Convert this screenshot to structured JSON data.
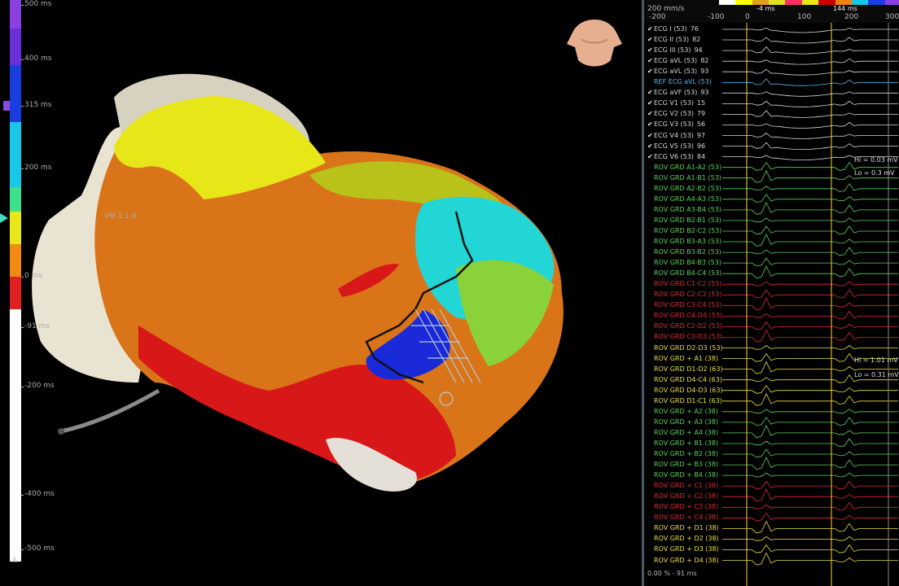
{
  "scale": {
    "ticks": [
      "500 ms",
      "400 ms",
      "315 ms",
      "200 ms",
      "0 ms",
      "-91 ms",
      "-200 ms",
      "-400 ms",
      "-500 ms"
    ],
    "colors": [
      "#8a3fe0",
      "#6a2fd8",
      "#1a3de0",
      "#19c8e8",
      "#3ee08a",
      "#e8e818",
      "#f08a10",
      "#e02020",
      "#ffffff"
    ]
  },
  "map": {
    "label": "VM 1.1.6"
  },
  "panel": {
    "sweep": "200 mm/s",
    "axis": [
      "-200",
      "-100",
      "0",
      "100",
      "200",
      "300"
    ],
    "ruler_a": "-4 ms",
    "ruler_b": "144 ms",
    "channels": [
      {
        "name": "ECG I (53)",
        "val": "76",
        "color": "#d8d8d8",
        "checked": true
      },
      {
        "name": "ECG II (53)",
        "val": "82",
        "color": "#d8d8d8",
        "checked": true
      },
      {
        "name": "ECG III (53)",
        "val": "94",
        "color": "#d8d8d8",
        "checked": true
      },
      {
        "name": "ECG aVL (53)",
        "val": "82",
        "color": "#d8d8d8",
        "checked": true
      },
      {
        "name": "ECG aVL (53)",
        "val": "93",
        "color": "#d8d8d8",
        "checked": true
      },
      {
        "name": "REF ECG aVL (53)",
        "val": "",
        "color": "#5ab8f0",
        "checked": false
      },
      {
        "name": "ECG aVF (53)",
        "val": "93",
        "color": "#d8d8d8",
        "checked": true
      },
      {
        "name": "ECG V1 (53)",
        "val": "15",
        "color": "#d8d8d8",
        "checked": true
      },
      {
        "name": "ECG V2 (53)",
        "val": "79",
        "color": "#d8d8d8",
        "checked": true
      },
      {
        "name": "ECG V3 (53)",
        "val": "56",
        "color": "#d8d8d8",
        "checked": true
      },
      {
        "name": "ECG V4 (53)",
        "val": "97",
        "color": "#d8d8d8",
        "checked": true
      },
      {
        "name": "ECG V5 (53)",
        "val": "96",
        "color": "#d8d8d8",
        "checked": true
      },
      {
        "name": "ECG V6 (53)",
        "val": "84",
        "color": "#d8d8d8",
        "checked": true
      },
      {
        "name": "ROV GRD A1-A2 (53)",
        "val": "",
        "color": "#5ad45a",
        "checked": false
      },
      {
        "name": "ROV GRD A1-B1 (53)",
        "val": "",
        "color": "#5ad45a",
        "checked": false
      },
      {
        "name": "ROV GRD A2-B2 (53)",
        "val": "",
        "color": "#5ad45a",
        "checked": false
      },
      {
        "name": "ROV GRD A4-A3 (53)",
        "val": "",
        "color": "#5ad45a",
        "checked": false
      },
      {
        "name": "ROV GRD A3-B4 (53)",
        "val": "",
        "color": "#5ad45a",
        "checked": false
      },
      {
        "name": "ROV GRD B2-B1 (53)",
        "val": "",
        "color": "#5ad45a",
        "checked": false
      },
      {
        "name": "ROV GRD B2-C2 (53)",
        "val": "",
        "color": "#5ad45a",
        "checked": false
      },
      {
        "name": "ROV GRD B3-A3 (53)",
        "val": "",
        "color": "#5ad45a",
        "checked": false
      },
      {
        "name": "ROV GRD B3-B2 (53)",
        "val": "",
        "color": "#5ad45a",
        "checked": false
      },
      {
        "name": "ROV GRD B4-B3 (53)",
        "val": "",
        "color": "#5ad45a",
        "checked": false
      },
      {
        "name": "ROV GRD B4-C4 (53)",
        "val": "",
        "color": "#5ad45a",
        "checked": false
      },
      {
        "name": "ROV GRD C1-C2 (53)",
        "val": "",
        "color": "#e0283a",
        "checked": false
      },
      {
        "name": "ROV GRD C2-C3 (53)",
        "val": "",
        "color": "#e0283a",
        "checked": false
      },
      {
        "name": "ROV GRD C3-C4 (53)",
        "val": "",
        "color": "#e0283a",
        "checked": false
      },
      {
        "name": "ROV GRD C4-D4 (53)",
        "val": "",
        "color": "#e0283a",
        "checked": false
      },
      {
        "name": "ROV GRD C2-D2 (53)",
        "val": "",
        "color": "#e0283a",
        "checked": false
      },
      {
        "name": "ROV GRD C3-D3 (53)",
        "val": "",
        "color": "#e0283a",
        "checked": false
      },
      {
        "name": "ROV GRD D2-D3 (53)",
        "val": "",
        "color": "#e8e040",
        "checked": false
      },
      {
        "name": "ROV GRD + A1 (38)",
        "val": "",
        "color": "#e8e040",
        "checked": false
      },
      {
        "name": "ROV GRD D1-D2 (63)",
        "val": "",
        "color": "#e8e040",
        "checked": false
      },
      {
        "name": "ROV GRD D4-C4 (63)",
        "val": "",
        "color": "#e8e040",
        "checked": false
      },
      {
        "name": "ROV GRD D4-D3 (63)",
        "val": "",
        "color": "#e8e040",
        "checked": false
      },
      {
        "name": "ROV GRD D1-C1 (63)",
        "val": "",
        "color": "#e8e040",
        "checked": false
      },
      {
        "name": "ROV GRD + A2 (38)",
        "val": "",
        "color": "#5ad45a",
        "checked": false
      },
      {
        "name": "ROV GRD + A3 (38)",
        "val": "",
        "color": "#5ad45a",
        "checked": false
      },
      {
        "name": "ROV GRD + A4 (38)",
        "val": "",
        "color": "#5ad45a",
        "checked": false
      },
      {
        "name": "ROV GRD + B1 (38)",
        "val": "",
        "color": "#5ad45a",
        "checked": false
      },
      {
        "name": "ROV GRD + B2 (38)",
        "val": "",
        "color": "#5ad45a",
        "checked": false
      },
      {
        "name": "ROV GRD + B3 (38)",
        "val": "",
        "color": "#5ad45a",
        "checked": false
      },
      {
        "name": "ROV GRD + B4 (38)",
        "val": "",
        "color": "#5ad45a",
        "checked": false
      },
      {
        "name": "ROV GRD + C1 (38)",
        "val": "",
        "color": "#e0283a",
        "checked": false
      },
      {
        "name": "ROV GRD + C2 (38)",
        "val": "",
        "color": "#e0283a",
        "checked": false
      },
      {
        "name": "ROV GRD + C3 (38)",
        "val": "",
        "color": "#e0283a",
        "checked": false
      },
      {
        "name": "ROV GRD + C4 (38)",
        "val": "",
        "color": "#e0283a",
        "checked": false
      },
      {
        "name": "ROV GRD + D1 (38)",
        "val": "",
        "color": "#e8e040",
        "checked": false
      },
      {
        "name": "ROV GRD + D2 (38)",
        "val": "",
        "color": "#e8e040",
        "checked": false
      },
      {
        "name": "ROV GRD + D3 (38)",
        "val": "",
        "color": "#e8e040",
        "checked": false
      },
      {
        "name": "ROV GRD + D4 (38)",
        "val": "",
        "color": "#e8e040",
        "checked": false
      }
    ],
    "notes": {
      "hi_top": "Hi = 0.03 mV",
      "lo_top": "Lo = 0.3 mV",
      "hi_bot": "Hi = 1.01 mV",
      "lo_bot": "Lo = 0.31 mV"
    },
    "footer": "0.00 % - 91 ms"
  }
}
